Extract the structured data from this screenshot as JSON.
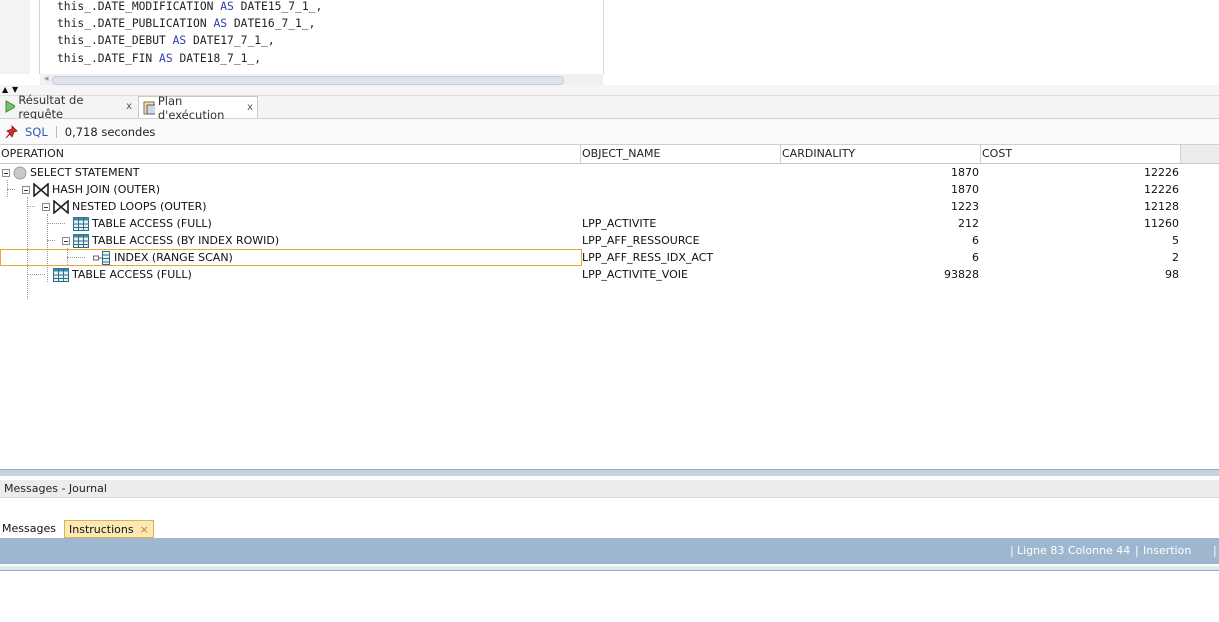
{
  "editor": {
    "lines": [
      {
        "pre": "this_.DATE_MODIFICATION ",
        "kw": "AS",
        "post": " DATE15_7_1_,"
      },
      {
        "pre": "this_.DATE_PUBLICATION ",
        "kw": "AS",
        "post": " DATE16_7_1_,"
      },
      {
        "pre": "this_.DATE_DEBUT ",
        "kw": "AS",
        "post": " DATE17_7_1_,"
      },
      {
        "pre": "this_.DATE_FIN ",
        "kw": "AS",
        "post": " DATE18_7_1_,"
      }
    ]
  },
  "tabs": [
    {
      "label": "Résultat de requête",
      "close": "x",
      "icon": "play-icon"
    },
    {
      "label": "Plan d'exécution",
      "close": "x",
      "icon": "explain-plan-icon"
    }
  ],
  "toolbar": {
    "pin_icon": "pin-icon",
    "sql_label": "SQL",
    "elapsed": "0,718 secondes"
  },
  "plan": {
    "headers": [
      "OPERATION",
      "OBJECT_NAME",
      "CARDINALITY",
      "COST"
    ],
    "rows": [
      {
        "op": "SELECT STATEMENT",
        "object": "",
        "cardinality": "1870",
        "cost": "12226",
        "depth": 0,
        "icon": "statement-icon",
        "expanded": true
      },
      {
        "op": "HASH JOIN (OUTER)",
        "object": "",
        "cardinality": "1870",
        "cost": "12226",
        "depth": 1,
        "icon": "join-icon",
        "expanded": true
      },
      {
        "op": "NESTED LOOPS (OUTER)",
        "object": "",
        "cardinality": "1223",
        "cost": "12128",
        "depth": 2,
        "icon": "join-icon",
        "expanded": true
      },
      {
        "op": "TABLE ACCESS (FULL)",
        "object": "LPP_ACTIVITE",
        "cardinality": "212",
        "cost": "11260",
        "depth": 3,
        "icon": "table-icon",
        "expanded": null
      },
      {
        "op": "TABLE ACCESS (BY INDEX ROWID)",
        "object": "LPP_AFF_RESSOURCE",
        "cardinality": "6",
        "cost": "5",
        "depth": 3,
        "icon": "table-icon",
        "expanded": true
      },
      {
        "op": "INDEX (RANGE SCAN)",
        "object": "LPP_AFF_RESS_IDX_ACT",
        "cardinality": "6",
        "cost": "2",
        "depth": 4,
        "icon": "index-icon",
        "expanded": null,
        "selected": true
      },
      {
        "op": "TABLE ACCESS (FULL)",
        "object": "LPP_ACTIVITE_VOIE",
        "cardinality": "93828",
        "cost": "98",
        "depth": 2,
        "icon": "table-icon",
        "expanded": null
      }
    ]
  },
  "messages_panel": {
    "title": "Messages - Journal"
  },
  "bottom_tabs": [
    {
      "label": "Messages"
    },
    {
      "label": "Instructions",
      "close": "×"
    }
  ],
  "status": {
    "position": "Ligne 83 Colonne 44",
    "mode": "Insertion"
  },
  "colors": {
    "keyword": "#2e3ea8",
    "selected_border": "#f0a437",
    "status_bar": "#9eb7cf",
    "instructions_tab": "#fbe8b2",
    "sql_link": "#2b5db4"
  }
}
